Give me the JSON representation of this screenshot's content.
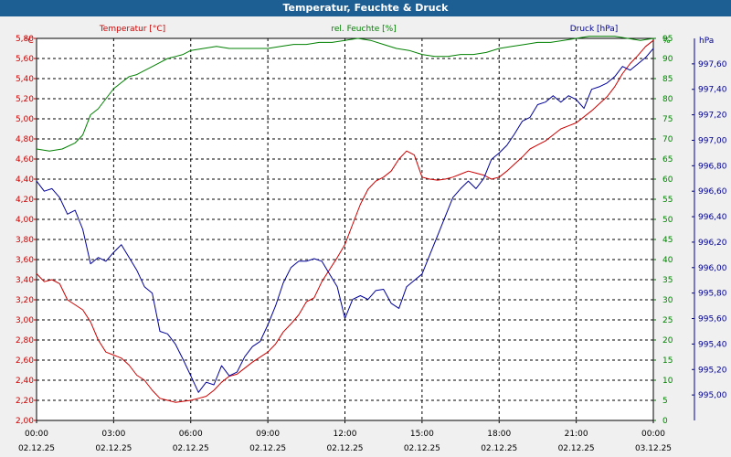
{
  "title": "Temperatur, Feuchte & Druck",
  "colors": {
    "temperature": "#cc0000",
    "humidity": "#008000",
    "pressure": "#000099",
    "title_bg": "#1e5f93",
    "grid": "#000000"
  },
  "chart_data": {
    "type": "line",
    "grid": true,
    "x_ticks": [
      {
        "time": "00:00",
        "date": "02.12.25"
      },
      {
        "time": "03:00",
        "date": "02.12.25"
      },
      {
        "time": "06:00",
        "date": "02.12.25"
      },
      {
        "time": "09:00",
        "date": "02.12.25"
      },
      {
        "time": "12:00",
        "date": "02.12.25"
      },
      {
        "time": "15:00",
        "date": "02.12.25"
      },
      {
        "time": "18:00",
        "date": "02.12.25"
      },
      {
        "time": "21:00",
        "date": "02.12.25"
      },
      {
        "time": "00:00",
        "date": "03.12.25"
      }
    ],
    "x_hours": [
      0,
      24
    ],
    "axes": {
      "temperature": {
        "label": "Temperatur [°C]",
        "unit": "°C",
        "min": 2.0,
        "max": 5.8,
        "ticks": [
          "2,00",
          "2,20",
          "2,40",
          "2,60",
          "2,80",
          "3,00",
          "3,20",
          "3,40",
          "3,60",
          "3,80",
          "4,00",
          "4,20",
          "4,40",
          "4,60",
          "4,80",
          "5,00",
          "5,20",
          "5,40",
          "5,60",
          "5,80"
        ]
      },
      "humidity": {
        "label": "rel. Feuchte [%]",
        "unit": "%",
        "min": 0,
        "max": 95,
        "ticks": [
          "0",
          "5",
          "10",
          "15",
          "20",
          "25",
          "30",
          "35",
          "40",
          "45",
          "50",
          "55",
          "60",
          "65",
          "70",
          "75",
          "80",
          "85",
          "90",
          "95"
        ]
      },
      "pressure": {
        "label": "Druck [hPa]",
        "unit": "hPa",
        "min": 994.8,
        "max": 997.8,
        "ticks": [
          "995,00",
          "995,20",
          "995,40",
          "995,60",
          "995,80",
          "996,00",
          "996,20",
          "996,40",
          "996,60",
          "996,80",
          "997,00",
          "997,20",
          "997,40",
          "997,60"
        ]
      }
    },
    "series": [
      {
        "name": "Temperatur",
        "axis": "temperature",
        "x": [
          0,
          0.3,
          0.6,
          0.9,
          1.2,
          1.5,
          1.8,
          2.1,
          2.4,
          2.7,
          3.0,
          3.3,
          3.6,
          3.9,
          4.2,
          4.5,
          4.8,
          5.1,
          5.4,
          5.7,
          6.0,
          6.3,
          6.6,
          6.9,
          7.2,
          7.5,
          7.8,
          8.1,
          8.4,
          8.7,
          9.0,
          9.3,
          9.6,
          9.9,
          10.2,
          10.5,
          10.8,
          11.1,
          11.4,
          11.7,
          12.0,
          12.3,
          12.6,
          12.9,
          13.2,
          13.5,
          13.8,
          14.1,
          14.4,
          14.7,
          15.0,
          15.3,
          15.6,
          15.9,
          16.2,
          16.5,
          16.8,
          17.1,
          17.4,
          17.7,
          18.0,
          18.3,
          18.6,
          18.9,
          19.2,
          19.5,
          19.8,
          20.1,
          20.4,
          20.7,
          21.0,
          21.3,
          21.6,
          21.9,
          22.2,
          22.5,
          22.8,
          23.1,
          23.4,
          23.7,
          24.0
        ],
        "y": [
          3.46,
          3.38,
          3.4,
          3.36,
          3.2,
          3.15,
          3.1,
          2.98,
          2.8,
          2.68,
          2.65,
          2.62,
          2.55,
          2.45,
          2.4,
          2.3,
          2.22,
          2.2,
          2.18,
          2.19,
          2.2,
          2.22,
          2.24,
          2.3,
          2.38,
          2.44,
          2.46,
          2.52,
          2.58,
          2.63,
          2.68,
          2.76,
          2.88,
          2.96,
          3.05,
          3.18,
          3.22,
          3.38,
          3.5,
          3.62,
          3.75,
          3.95,
          4.15,
          4.3,
          4.38,
          4.42,
          4.48,
          4.6,
          4.68,
          4.64,
          4.42,
          4.4,
          4.39,
          4.4,
          4.42,
          4.45,
          4.48,
          4.46,
          4.44,
          4.4,
          4.42,
          4.48,
          4.55,
          4.62,
          4.7,
          4.74,
          4.78,
          4.84,
          4.9,
          4.93,
          4.96,
          5.02,
          5.08,
          5.15,
          5.22,
          5.32,
          5.45,
          5.55,
          5.63,
          5.72,
          5.78
        ]
      },
      {
        "name": "rel. Feuchte",
        "axis": "humidity",
        "x": [
          0,
          0.5,
          1.0,
          1.5,
          1.8,
          2.1,
          2.4,
          2.7,
          3.0,
          3.3,
          3.6,
          3.9,
          4.2,
          4.5,
          4.8,
          5.1,
          5.4,
          5.7,
          6.0,
          6.5,
          7.0,
          7.5,
          8.0,
          8.5,
          9.0,
          9.5,
          10.0,
          10.5,
          11.0,
          11.5,
          12.0,
          12.5,
          13.0,
          13.5,
          14.0,
          14.5,
          15.0,
          15.5,
          16.0,
          16.5,
          17.0,
          17.5,
          18.0,
          18.5,
          19.0,
          19.5,
          20.0,
          20.5,
          21.0,
          21.5,
          22.0,
          22.5,
          23.0,
          23.5,
          24.0
        ],
        "y": [
          67.5,
          67,
          67.5,
          69,
          71,
          76,
          77.5,
          80,
          82.5,
          84,
          85.5,
          86,
          87,
          88,
          89,
          90,
          90.5,
          91,
          92,
          92.5,
          93,
          92.5,
          92.5,
          92.5,
          92.5,
          93,
          93.5,
          93.5,
          94,
          94,
          94.5,
          95,
          94.5,
          93.5,
          92.5,
          92,
          91,
          90.5,
          90.5,
          91,
          91,
          91.5,
          92.5,
          93,
          93.5,
          94,
          94,
          94.5,
          95,
          95.5,
          95.5,
          95.5,
          95,
          94.5,
          95
        ]
      },
      {
        "name": "Druck",
        "axis": "pressure",
        "x": [
          0,
          0.3,
          0.6,
          0.9,
          1.2,
          1.5,
          1.8,
          2.1,
          2.4,
          2.7,
          3.0,
          3.3,
          3.6,
          3.9,
          4.2,
          4.5,
          4.8,
          5.1,
          5.4,
          5.7,
          6.0,
          6.3,
          6.6,
          6.9,
          7.2,
          7.5,
          7.8,
          8.1,
          8.4,
          8.7,
          9.0,
          9.3,
          9.6,
          9.9,
          10.2,
          10.5,
          10.8,
          11.1,
          11.4,
          11.7,
          12.0,
          12.3,
          12.6,
          12.9,
          13.2,
          13.5,
          13.8,
          14.1,
          14.4,
          14.7,
          15.0,
          15.3,
          15.6,
          15.9,
          16.2,
          16.5,
          16.8,
          17.1,
          17.4,
          17.7,
          18.0,
          18.3,
          18.6,
          18.9,
          19.2,
          19.5,
          19.8,
          20.1,
          20.4,
          20.7,
          21.0,
          21.3,
          21.6,
          21.9,
          22.2,
          22.5,
          22.8,
          23.1,
          23.4,
          23.7,
          24.0
        ],
        "y": [
          996.68,
          996.6,
          996.62,
          996.55,
          996.42,
          996.45,
          996.3,
          996.03,
          996.08,
          996.05,
          996.12,
          996.18,
          996.08,
          995.98,
          995.85,
          995.8,
          995.5,
          995.48,
          995.4,
          995.28,
          995.15,
          995.02,
          995.1,
          995.08,
          995.23,
          995.15,
          995.18,
          995.3,
          995.38,
          995.42,
          995.55,
          995.7,
          995.88,
          996.0,
          996.05,
          996.05,
          996.07,
          996.05,
          995.95,
          995.85,
          995.6,
          995.75,
          995.78,
          995.75,
          995.82,
          995.83,
          995.72,
          995.68,
          995.85,
          995.9,
          995.95,
          996.1,
          996.25,
          996.4,
          996.55,
          996.62,
          996.68,
          996.62,
          996.7,
          996.85,
          996.9,
          996.96,
          997.05,
          997.15,
          997.18,
          997.28,
          997.3,
          997.35,
          997.3,
          997.35,
          997.32,
          997.25,
          997.4,
          997.42,
          997.45,
          997.5,
          997.58,
          997.55,
          997.6,
          997.65,
          997.72
        ]
      }
    ]
  }
}
